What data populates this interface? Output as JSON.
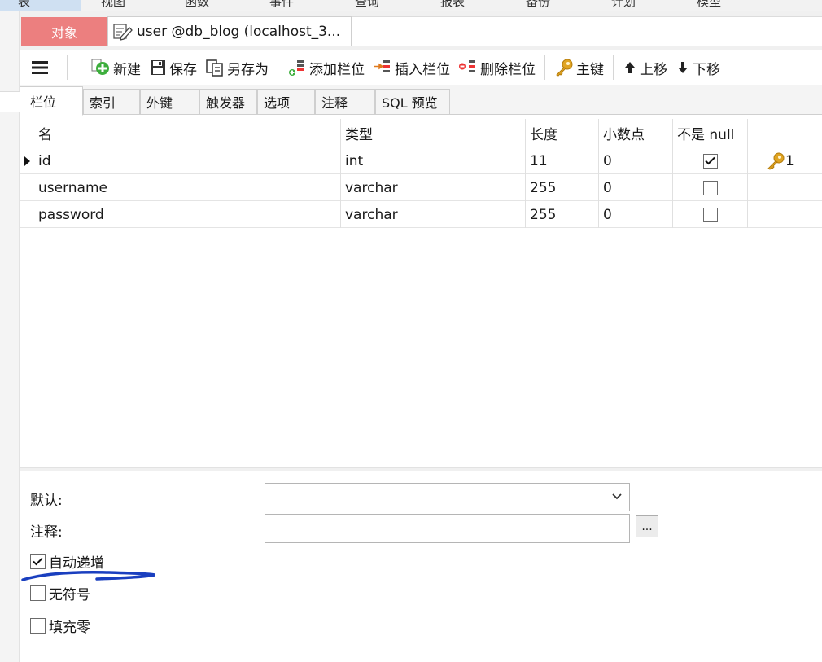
{
  "menu": {
    "items": [
      "表",
      "视图",
      "函数",
      "事件",
      "查询",
      "报表",
      "备份",
      "计划",
      "模型"
    ]
  },
  "tabs": {
    "object_label": "对象",
    "document_title": "user @db_blog (localhost_3..."
  },
  "toolbar": {
    "new_label": "新建",
    "save_label": "保存",
    "save_as_label": "另存为",
    "add_field_label": "添加栏位",
    "insert_field_label": "插入栏位",
    "delete_field_label": "删除栏位",
    "primary_key_label": "主键",
    "move_up_label": "上移",
    "move_down_label": "下移"
  },
  "subtabs": [
    "栏位",
    "索引",
    "外键",
    "触发器",
    "选项",
    "注释",
    "SQL 预览"
  ],
  "grid": {
    "columns": [
      "名",
      "类型",
      "长度",
      "小数点",
      "不是 null"
    ],
    "rows": [
      {
        "name": "id",
        "type": "int",
        "length": "11",
        "decimals": "0",
        "not_null": true,
        "key": "1"
      },
      {
        "name": "username",
        "type": "varchar",
        "length": "255",
        "decimals": "0",
        "not_null": false,
        "key": ""
      },
      {
        "name": "password",
        "type": "varchar",
        "length": "255",
        "decimals": "0",
        "not_null": false,
        "key": ""
      }
    ]
  },
  "props": {
    "default_label": "默认:",
    "comment_label": "注释:",
    "dots_label": "...",
    "auto_increment_label": "自动递增",
    "auto_increment": true,
    "unsigned_label": "无符号",
    "unsigned": false,
    "zerofill_label": "填充零",
    "zerofill": false
  },
  "colors": {
    "object_tab": "#ec7f7f",
    "key_icon": "#e0a422",
    "annotation": "#1a3fbf"
  }
}
